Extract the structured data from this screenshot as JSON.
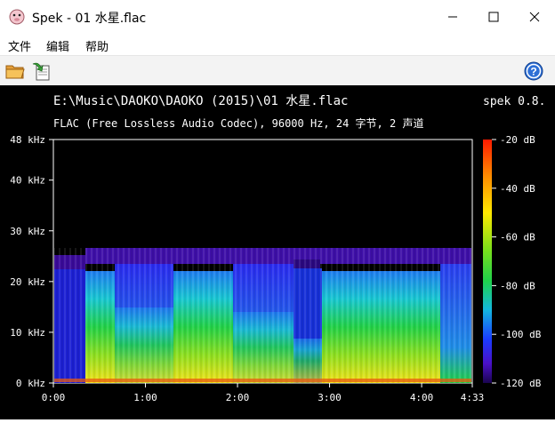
{
  "window": {
    "title": "Spek - 01 水星.flac"
  },
  "menu": {
    "items": [
      {
        "label": "文件"
      },
      {
        "label": "编辑"
      },
      {
        "label": "帮助"
      }
    ]
  },
  "toolbar": {
    "open_icon": "folder-open-icon",
    "save_icon": "save-export-icon",
    "help_icon": "help-icon"
  },
  "spectrogram": {
    "file_path": "E:\\Music\\DAOKO\\DAOKO (2015)\\01 水星.flac",
    "app_label": "spek 0.8.",
    "info": "FLAC (Free Lossless Audio Codec), 96000 Hz, 24 字节, 2 声道",
    "freq_axis": {
      "ticks": [
        {
          "label": "48 kHz",
          "value": 48
        },
        {
          "label": "40 kHz",
          "value": 40
        },
        {
          "label": "30 kHz",
          "value": 30
        },
        {
          "label": "20 kHz",
          "value": 20
        },
        {
          "label": "10 kHz",
          "value": 10
        },
        {
          "label": "0 kHz",
          "value": 0
        }
      ]
    },
    "time_axis": {
      "ticks": [
        {
          "label": "0:00",
          "value": 0
        },
        {
          "label": "1:00",
          "value": 60
        },
        {
          "label": "2:00",
          "value": 120
        },
        {
          "label": "3:00",
          "value": 180
        },
        {
          "label": "4:00",
          "value": 240
        },
        {
          "label": "4:33",
          "value": 273
        }
      ]
    },
    "db_scale": {
      "ticks": [
        {
          "label": "-20 dB",
          "value": -20
        },
        {
          "label": "-40 dB",
          "value": -40
        },
        {
          "label": "-60 dB",
          "value": -60
        },
        {
          "label": "-80 dB",
          "value": -80
        },
        {
          "label": "-100 dB",
          "value": -100
        },
        {
          "label": "-120 dB",
          "value": -120
        }
      ]
    },
    "colors": {
      "background": "#000000",
      "text": "#ffffff",
      "accent_purple": "#6a1bd8",
      "accent_blue": "#1a48ff",
      "accent_green": "#26d23c",
      "accent_yellow": "#e8e800"
    }
  }
}
